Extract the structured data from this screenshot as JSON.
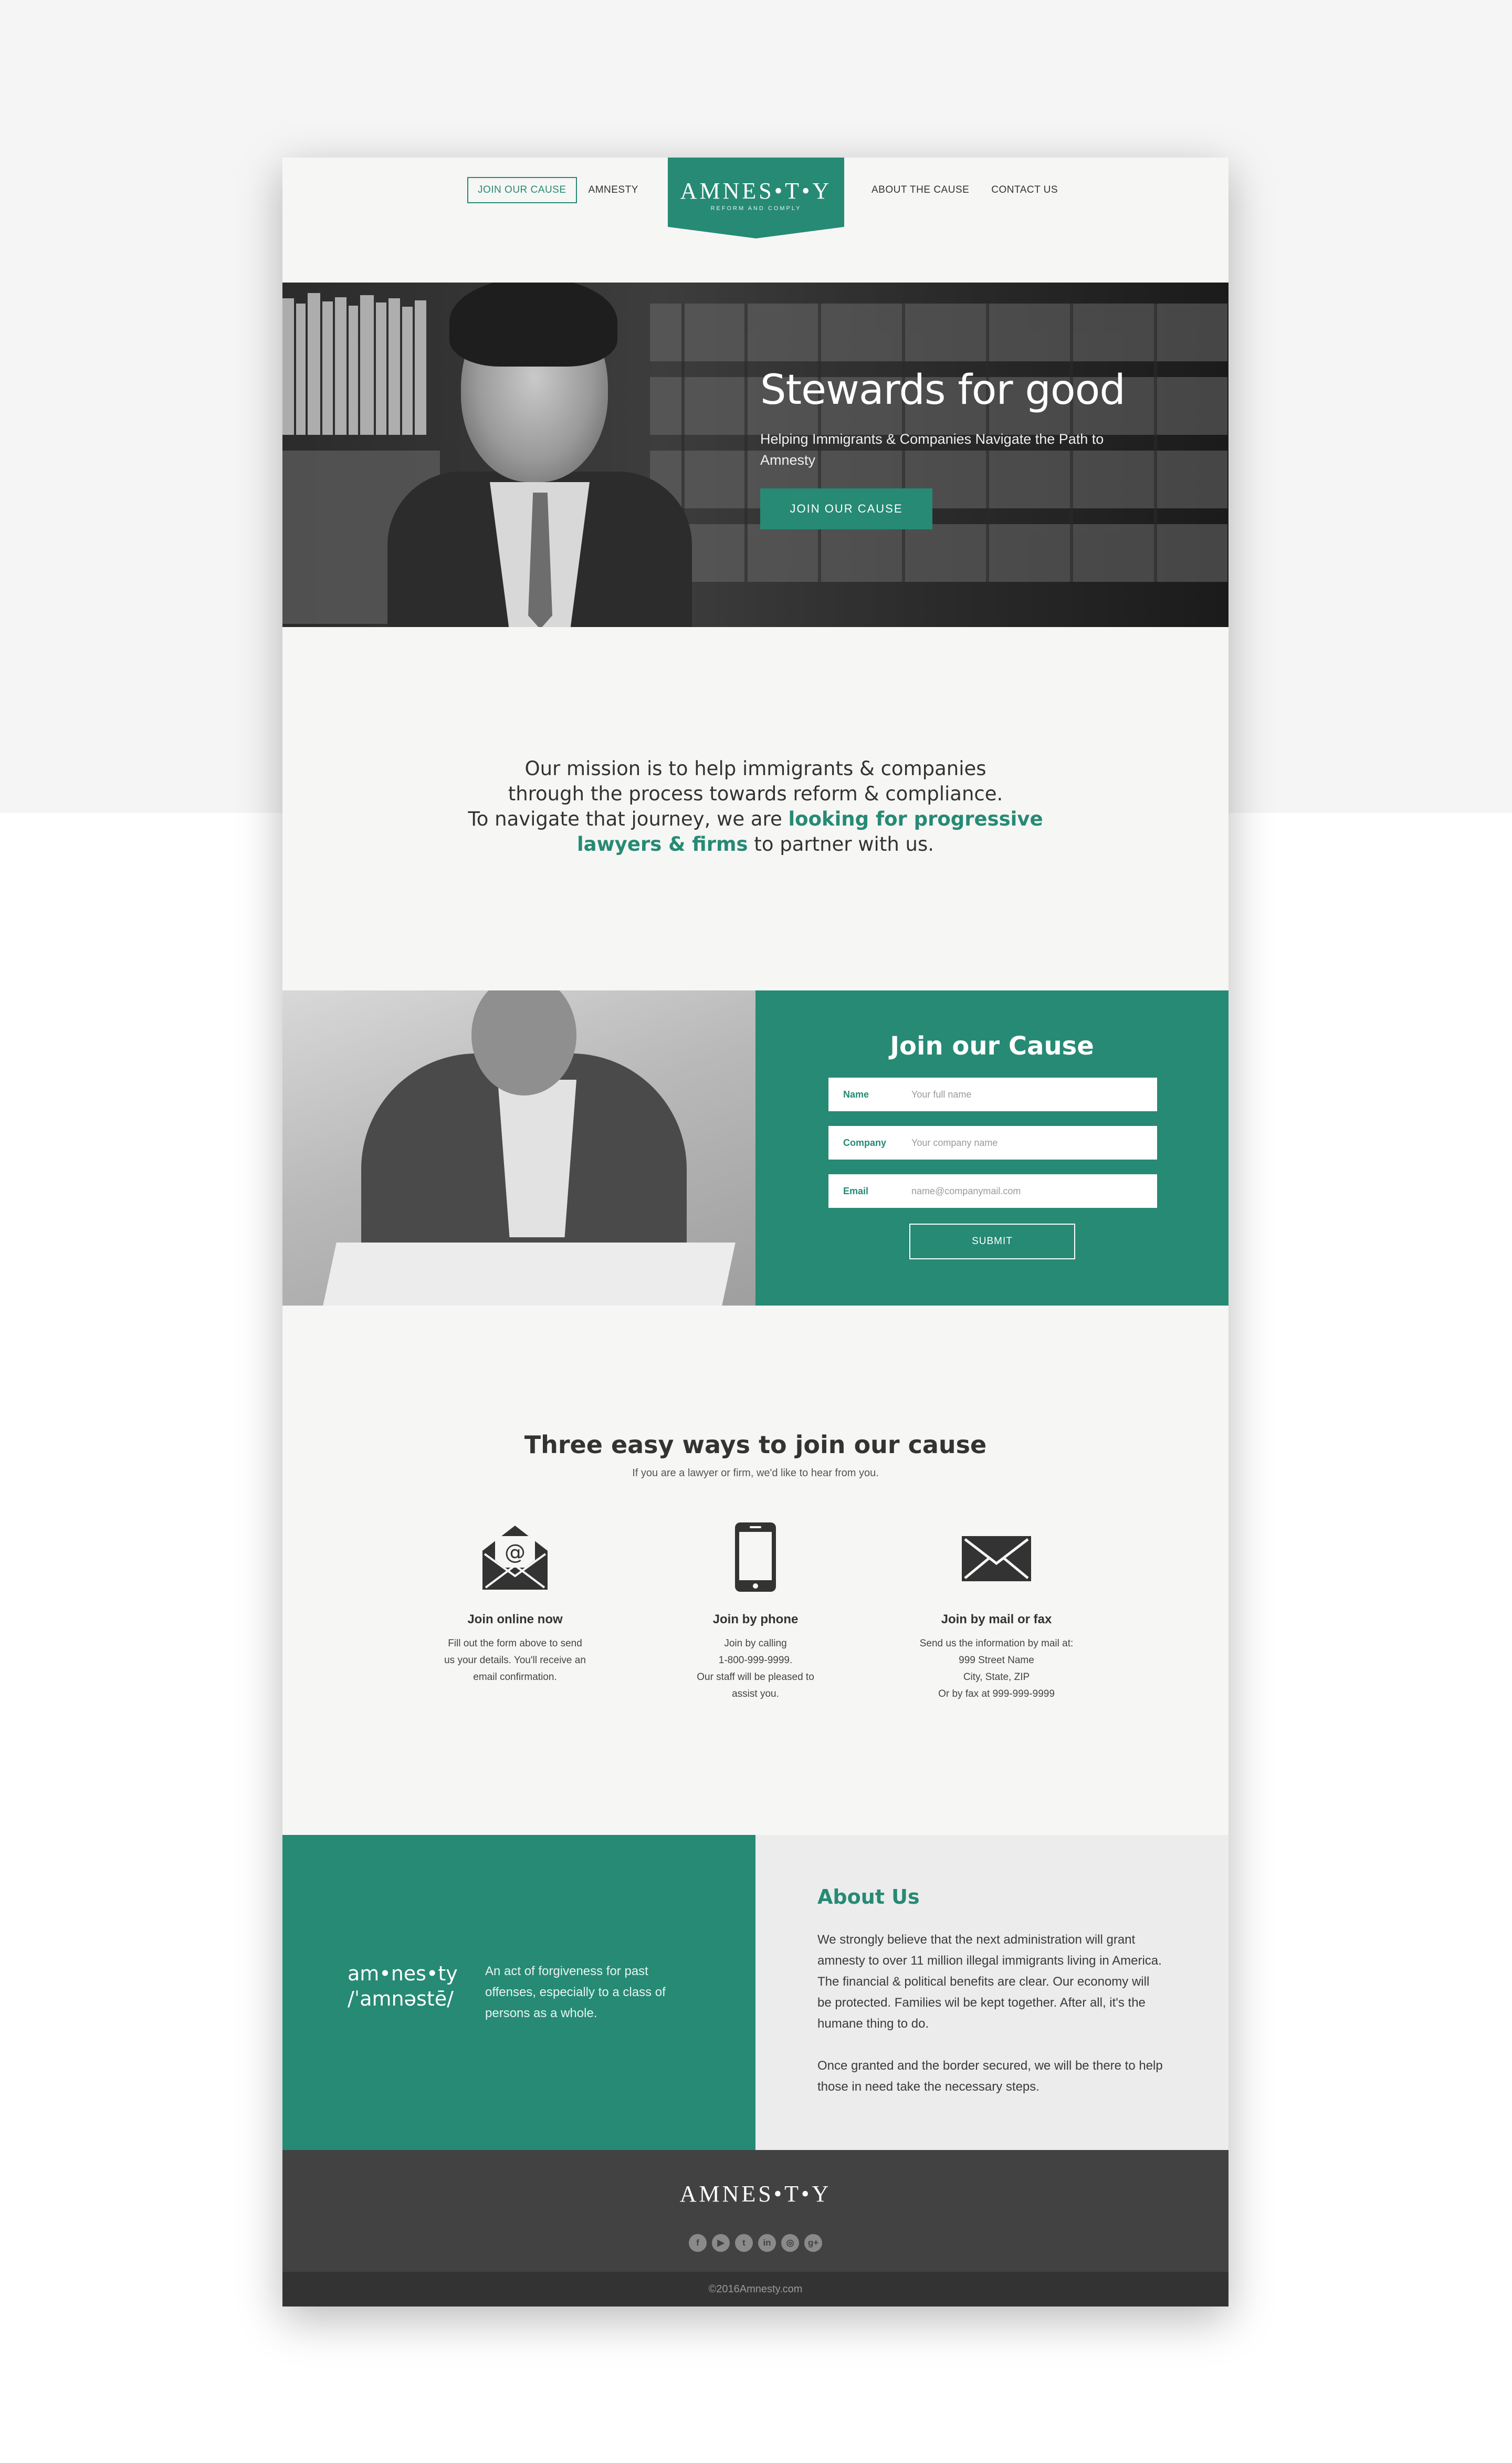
{
  "nav": {
    "join_label": "JOIN OUR CAUSE",
    "amnesty_label": "AMNESTY",
    "about_label": "ABOUT THE CAUSE",
    "contact_label": "CONTACT US"
  },
  "logo": {
    "word": "AMNES•T•Y",
    "tagline": "REFORM AND COMPLY"
  },
  "hero": {
    "title": "Stewards for good",
    "subtitle": "Helping Immigrants & Companies Navigate the Path to Amnesty",
    "button": "JOIN OUR CAUSE"
  },
  "mission": {
    "line1": "Our mission is to help immigrants & companies",
    "line2": "through the process towards reform & compliance.",
    "line3_pre": "To navigate that journey, we are ",
    "line3_hl": "looking for progressive",
    "line4_hl": "lawyers & firms",
    "line4_post": " to partner with us."
  },
  "join_form": {
    "title": "Join our Cause",
    "name_label": "Name",
    "name_placeholder": "Your full name",
    "company_label": "Company",
    "company_placeholder": "Your company name",
    "email_label": "Email",
    "email_placeholder": "name@companymail.com",
    "submit": "SUBMIT"
  },
  "ways": {
    "title": "Three easy ways to join our cause",
    "subtitle": "If you are a lawyer or firm, we'd like to hear from you.",
    "items": [
      {
        "icon": "email-open-icon",
        "title": "Join online now",
        "lines": [
          "Fill out the form above to send",
          "us your details. You'll receive an",
          "email confirmation."
        ]
      },
      {
        "icon": "phone-icon",
        "title": "Join by phone",
        "lines": [
          "Join by calling",
          "1-800-999-9999.",
          "Our staff will be pleased to",
          "assist you."
        ]
      },
      {
        "icon": "envelope-icon",
        "title": "Join by mail or fax",
        "lines": [
          "Send us the information by mail at:",
          "999 Street Name",
          "City, State, ZIP",
          "Or by fax at 999-999-9999"
        ]
      }
    ]
  },
  "definition": {
    "word_line1": "am•nes•ty",
    "word_line2": "/ˈamnəstē/",
    "text": "An act of forgiveness for past offenses, especially to a class of persons as a whole."
  },
  "about": {
    "title": "About Us",
    "p1": "We strongly believe that the next administration will grant amnesty to over 11 million illegal immigrants living in America. The financial & political benefits are clear. Our economy will be protected. Families wil be kept together. After all, it's the humane thing to do.",
    "p2": "Once granted and the border secured, we will be there to help those in need take the necessary steps."
  },
  "footer": {
    "logo": "AMNES•T•Y",
    "social": [
      {
        "icon": "facebook-icon",
        "glyph": "f"
      },
      {
        "icon": "youtube-icon",
        "glyph": "▶"
      },
      {
        "icon": "twitter-icon",
        "glyph": "t"
      },
      {
        "icon": "linkedin-icon",
        "glyph": "in"
      },
      {
        "icon": "instagram-icon",
        "glyph": "◎"
      },
      {
        "icon": "googleplus-icon",
        "glyph": "g+"
      }
    ],
    "copyright": "©2016Amnesty.com"
  },
  "colors": {
    "accent": "#268a75",
    "footer": "#424242",
    "copyright_bar": "#333333"
  }
}
